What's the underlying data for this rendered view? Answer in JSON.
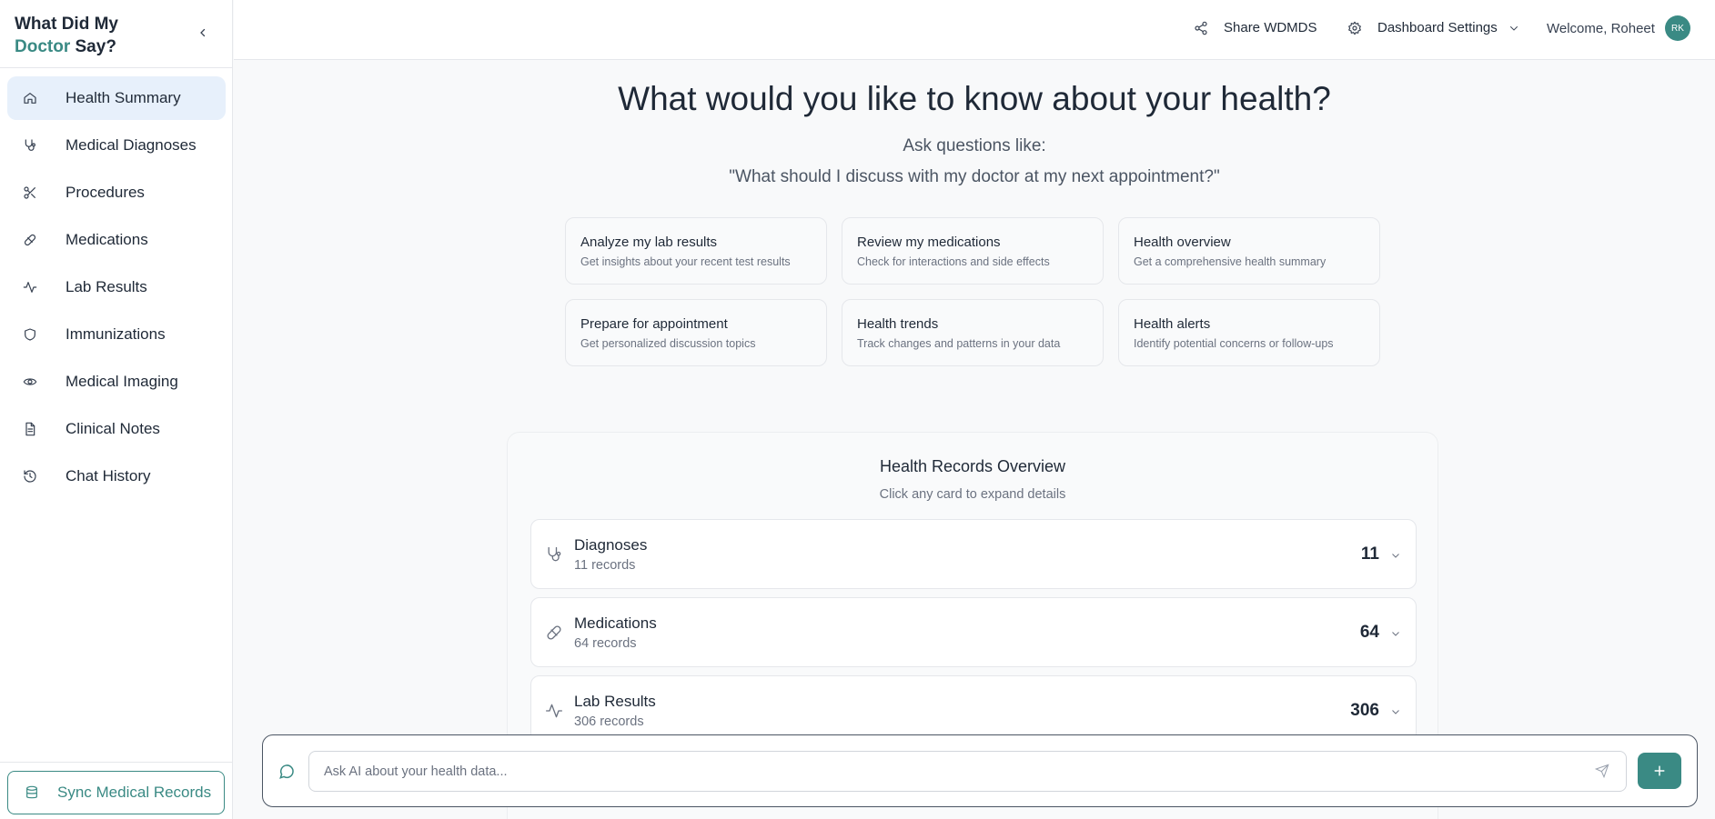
{
  "brand": {
    "line1": "What Did My",
    "accent": "Doctor",
    "rest": " Say?"
  },
  "sidebar": {
    "items": [
      {
        "label": "Health Summary",
        "icon": "home-icon",
        "active": true
      },
      {
        "label": "Medical Diagnoses",
        "icon": "stethoscope-icon"
      },
      {
        "label": "Procedures",
        "icon": "scissors-icon"
      },
      {
        "label": "Medications",
        "icon": "pill-icon"
      },
      {
        "label": "Lab Results",
        "icon": "activity-icon"
      },
      {
        "label": "Immunizations",
        "icon": "shield-icon"
      },
      {
        "label": "Medical Imaging",
        "icon": "eye-icon"
      },
      {
        "label": "Clinical Notes",
        "icon": "file-text-icon"
      },
      {
        "label": "Chat History",
        "icon": "history-icon"
      }
    ],
    "sync_label": "Sync Medical Records"
  },
  "header": {
    "share_label": "Share WDMDS",
    "settings_label": "Dashboard Settings",
    "welcome": "Welcome, Roheet",
    "avatar_initials": "RK"
  },
  "hero": {
    "title": "What would you like to know about your health?",
    "subtitle": "Ask questions like:",
    "example": "\"What should I discuss with my doctor at my next appointment?\""
  },
  "quick_cards": [
    {
      "title": "Analyze my lab results",
      "subtitle": "Get insights about your recent test results"
    },
    {
      "title": "Review my medications",
      "subtitle": "Check for interactions and side effects"
    },
    {
      "title": "Health overview",
      "subtitle": "Get a comprehensive health summary"
    },
    {
      "title": "Prepare for appointment",
      "subtitle": "Get personalized discussion topics"
    },
    {
      "title": "Health trends",
      "subtitle": "Track changes and patterns in your data"
    },
    {
      "title": "Health alerts",
      "subtitle": "Identify potential concerns or follow-ups"
    }
  ],
  "overview": {
    "title": "Health Records Overview",
    "subtitle": "Click any card to expand details",
    "records": [
      {
        "title": "Diagnoses",
        "subtitle": "11 records",
        "count": "11",
        "icon": "stethoscope-icon"
      },
      {
        "title": "Medications",
        "subtitle": "64 records",
        "count": "64",
        "icon": "pill-icon"
      },
      {
        "title": "Lab Results",
        "subtitle": "306 records",
        "count": "306",
        "icon": "activity-icon"
      }
    ]
  },
  "chat": {
    "placeholder": "Ask AI about your health data..."
  },
  "colors": {
    "accent": "#3a8a84",
    "active_nav": "#e7f0fb"
  }
}
